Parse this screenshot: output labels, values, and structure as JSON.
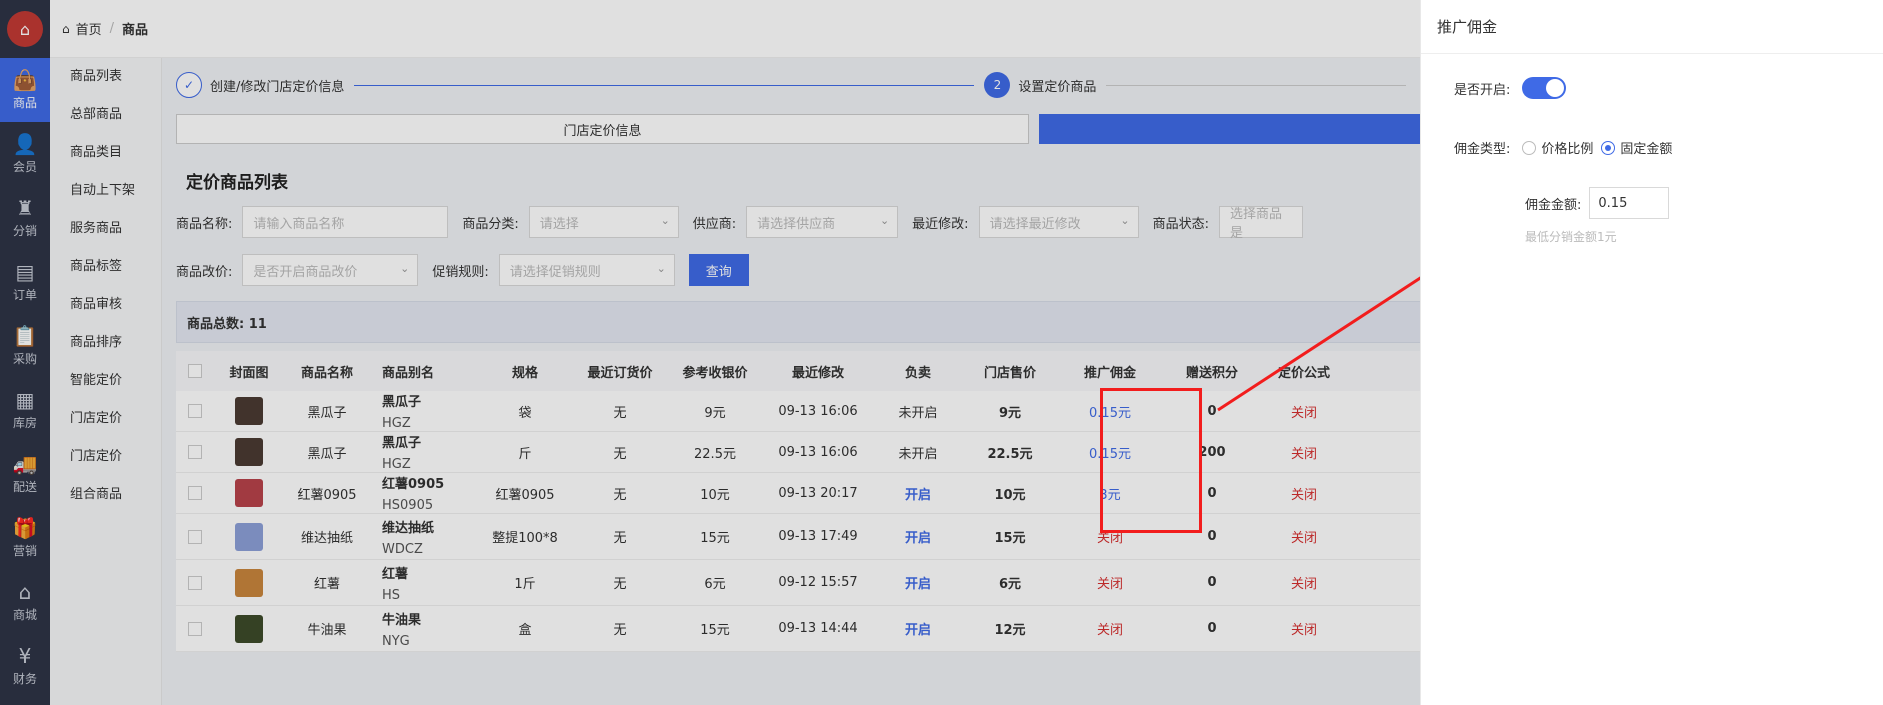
{
  "nav": [
    {
      "label": "商品",
      "icon": "bag-icon",
      "glyph": "👜",
      "active": true
    },
    {
      "label": "会员",
      "icon": "user-icon",
      "glyph": "👤"
    },
    {
      "label": "分销",
      "icon": "network-icon",
      "glyph": "♜"
    },
    {
      "label": "订单",
      "icon": "order-icon",
      "glyph": "▤"
    },
    {
      "label": "采购",
      "icon": "clipboard-icon",
      "glyph": "📋"
    },
    {
      "label": "库房",
      "icon": "warehouse-icon",
      "glyph": "▦"
    },
    {
      "label": "配送",
      "icon": "truck-icon",
      "glyph": "🚚"
    },
    {
      "label": "营销",
      "icon": "gift-icon",
      "glyph": "🎁"
    },
    {
      "label": "商城",
      "icon": "home-icon",
      "glyph": "⌂"
    },
    {
      "label": "财务",
      "icon": "yen-icon",
      "glyph": "¥"
    }
  ],
  "subnav": [
    "商品列表",
    "总部商品",
    "商品类目",
    "自动上下架",
    "服务商品",
    "商品标签",
    "商品审核",
    "商品排序",
    "智能定价",
    "门店定价",
    "门店定价",
    "组合商品"
  ],
  "breadcrumb": {
    "home": "首页",
    "current": "商品"
  },
  "steps": {
    "step1": "创建/修改门店定价信息",
    "step2_num": "2",
    "step2": "设置定价商品"
  },
  "tab1": "门店定价信息",
  "section_title": "定价商品列表",
  "filters": {
    "name_label": "商品名称:",
    "name_ph": "请输入商品名称",
    "cat_label": "商品分类:",
    "cat_ph": "请选择",
    "sup_label": "供应商:",
    "sup_ph": "请选择供应商",
    "mod_label": "最近修改:",
    "mod_ph": "请选择最近修改",
    "status_label": "商品状态:",
    "status_ph": "选择商品是",
    "price_label": "商品改价:",
    "price_ph": "是否开启商品改价",
    "promo_label": "促销规则:",
    "promo_ph": "请选择促销规则",
    "query": "查询"
  },
  "total": "商品总数: 11",
  "columns": [
    "封面图",
    "商品名称",
    "商品别名",
    "规格",
    "最近订货价",
    "参考收银价",
    "最近修改",
    "负卖",
    "门店售价",
    "推广佣金",
    "赠送积分",
    "定价公式"
  ],
  "rows": [
    {
      "name": "黑瓜子",
      "alias": "黑瓜子",
      "code": "HGZ",
      "spec": "袋",
      "last": "无",
      "ref": "9元",
      "mod": "09-13 16:06",
      "neg": "未开启",
      "sale": "9元",
      "comm": "0.15元",
      "pts": "0",
      "formula": "关闭",
      "img": "#4a3b33"
    },
    {
      "name": "黑瓜子",
      "alias": "黑瓜子",
      "code": "HGZ",
      "spec": "斤",
      "last": "无",
      "ref": "22.5元",
      "mod": "09-13 16:06",
      "neg": "未开启",
      "sale": "22.5元",
      "comm": "0.15元",
      "pts": "200",
      "formula": "关闭",
      "img": "#4a3b33"
    },
    {
      "name": "红薯0905",
      "alias": "红薯0905",
      "code": "HS0905",
      "spec": "红薯0905",
      "last": "无",
      "ref": "10元",
      "mod": "09-13 20:17",
      "neg": "开启",
      "sale": "10元",
      "comm": "3元",
      "pts": "0",
      "formula": "关闭",
      "img": "#b8424b"
    },
    {
      "name": "维达抽纸",
      "alias": "维达抽纸",
      "code": "WDCZ",
      "spec": "整提100*8",
      "last": "无",
      "ref": "15元",
      "mod": "09-13 17:49",
      "neg": "开启",
      "sale": "15元",
      "comm": "关闭",
      "pts": "0",
      "formula": "关闭",
      "img": "#8da0d8"
    },
    {
      "name": "红薯",
      "alias": "红薯",
      "code": "HS",
      "spec": "1斤",
      "last": "无",
      "ref": "6元",
      "mod": "09-12 15:57",
      "neg": "开启",
      "sale": "6元",
      "comm": "关闭",
      "pts": "0",
      "formula": "关闭",
      "img": "#c9863d"
    },
    {
      "name": "牛油果",
      "alias": "牛油果",
      "code": "NYG",
      "spec": "盒",
      "last": "无",
      "ref": "15元",
      "mod": "09-13 14:44",
      "neg": "开启",
      "sale": "12元",
      "comm": "关闭",
      "pts": "0",
      "formula": "关闭",
      "img": "#3d4a2a"
    }
  ],
  "drawer": {
    "title": "推广佣金",
    "enable_label": "是否开启:",
    "type_label": "佣金类型:",
    "opt1": "价格比例",
    "opt2": "固定金额",
    "amount_label": "佣金金额:",
    "amount_value": "0.15",
    "hint": "最低分销金额1元"
  },
  "colors": {
    "accent": "#3f6ae6",
    "danger": "#d62f2f",
    "annotation": "#f21d1d"
  }
}
